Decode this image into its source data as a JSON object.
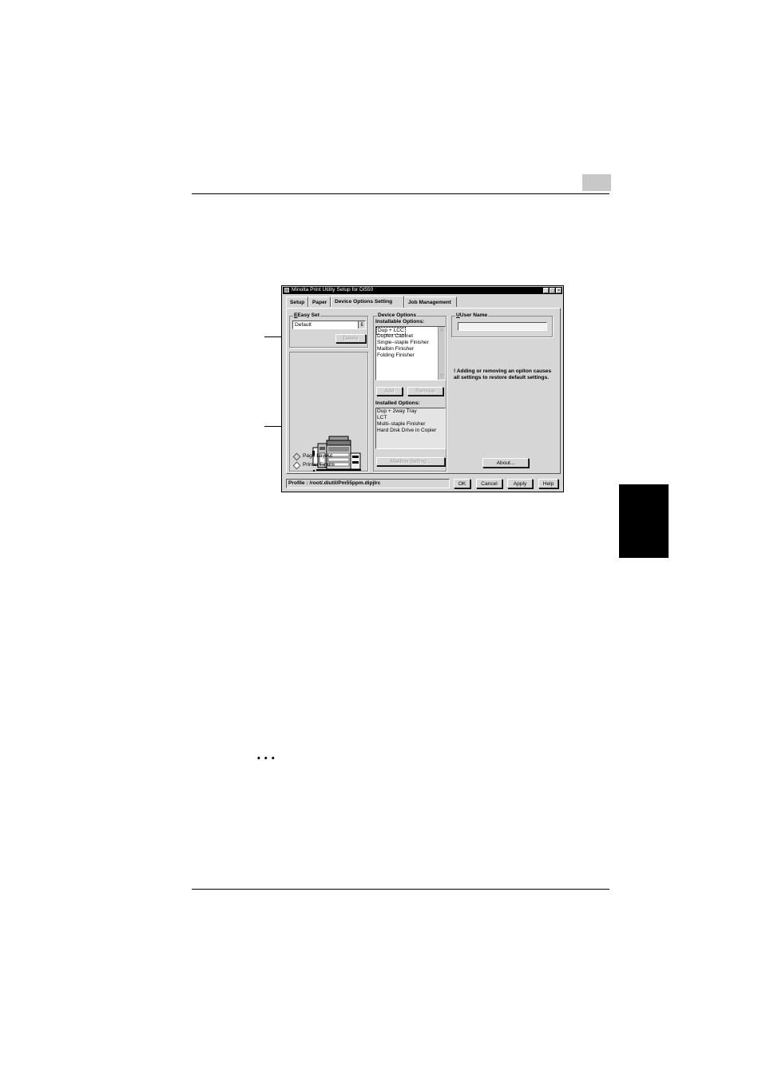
{
  "page": {
    "chapter_box_color": "#c8c8c8",
    "thumb_tab_color": "#000000",
    "ellipsis": "• • •"
  },
  "window": {
    "title": "Minolta Print Utility Setup for Di550",
    "title_buttons": {
      "minimize": "_",
      "maximize": "□",
      "close": "×"
    },
    "tabs": [
      {
        "label": "Setup",
        "active": false
      },
      {
        "label": "Paper",
        "active": false
      },
      {
        "label": "Device Options Setting",
        "active": true
      },
      {
        "label": "Job Management",
        "active": false
      }
    ],
    "easy_set": {
      "group_label": "Easy Set",
      "selected_value": "Default",
      "combo_icon": "dropdown-arrow-icon",
      "delete_label": "Delete"
    },
    "preview": {
      "printer_icon": "printer-figure-icon",
      "radio_options": [
        {
          "label": "Page Layout",
          "selected": false
        },
        {
          "label": "Printer Figure",
          "selected": true
        }
      ]
    },
    "device_options": {
      "group_label": "Device Options",
      "installable_label": "Installable Options:",
      "installable_items": [
        "Dup + LCC",
        "Duplex Cabinet",
        "Single–staple Finisher",
        "Mailbin Finisher",
        "Folding Finisher"
      ],
      "add_label": "Add",
      "remove_label": "Remove",
      "installed_label": "Installed Options:",
      "installed_items": [
        "Dup + 2way Tray",
        "LCT",
        "Multi–staple Finisher",
        "Hard Disk Drive in Copier"
      ],
      "mailbox_label": "Mailbox Setting..."
    },
    "user_name": {
      "group_label": "User Name",
      "value": ""
    },
    "warning": "! Adding or removing an opiton causes all settings to restore default settings.",
    "about_label": "About...",
    "status": {
      "profile": "Profile : /root/.diutil/Pm55ppm.dipjlrc"
    },
    "buttons": {
      "ok": "OK",
      "cancel": "Cancel",
      "apply": "Apply",
      "help": "Help"
    }
  }
}
